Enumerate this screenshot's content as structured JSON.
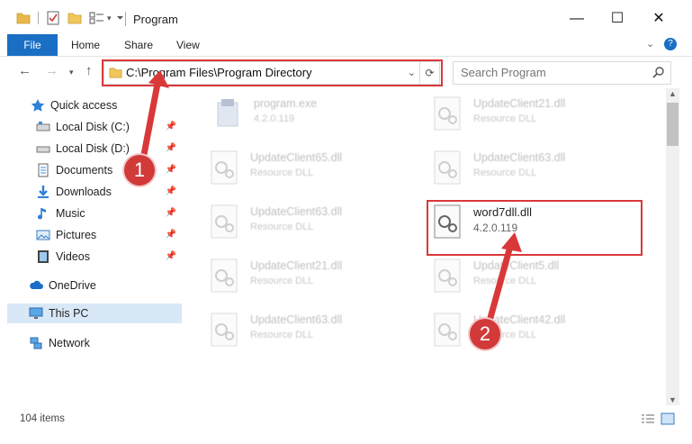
{
  "window": {
    "title": "Program",
    "controls": {
      "minimize": "—",
      "maximize": "☐",
      "close": "✕"
    }
  },
  "ribbon": {
    "tabs": [
      "File",
      "Home",
      "Share",
      "View"
    ]
  },
  "navigation": {
    "address": "C:\\Program Files\\Program Directory",
    "search_placeholder": "Search Program"
  },
  "sidebar": {
    "items": [
      {
        "label": "Quick access",
        "icon": "star-icon"
      },
      {
        "label": "Local Disk (C:)",
        "icon": "drive-icon",
        "pinned": true
      },
      {
        "label": "Local Disk (D:)",
        "icon": "drive-icon",
        "pinned": true
      },
      {
        "label": "Documents",
        "icon": "documents-icon",
        "pinned": true
      },
      {
        "label": "Downloads",
        "icon": "download-icon",
        "pinned": true
      },
      {
        "label": "Music",
        "icon": "music-icon",
        "pinned": true
      },
      {
        "label": "Pictures",
        "icon": "pictures-icon",
        "pinned": true
      },
      {
        "label": "Videos",
        "icon": "videos-icon",
        "pinned": true
      },
      {
        "label": "OneDrive",
        "icon": "cloud-icon"
      },
      {
        "label": "This PC",
        "icon": "computer-icon",
        "selected": true
      },
      {
        "label": "Network",
        "icon": "network-icon"
      }
    ]
  },
  "files": [
    {
      "name": "program.exe",
      "sub": "4.2.0.119"
    },
    {
      "name": "UpdateClient21.dll",
      "sub": "Resource DLL"
    },
    {
      "name": "UpdateClient65.dll",
      "sub": "Resource DLL"
    },
    {
      "name": "UpdateClient63.dll",
      "sub": "Resource DLL"
    },
    {
      "name": "UpdateClient63.dll",
      "sub": "Resource DLL"
    },
    {
      "name": "word7dll.dll",
      "sub": "4.2.0.119",
      "selected": true
    },
    {
      "name": "UpdateClient21.dll",
      "sub": "Resource DLL"
    },
    {
      "name": "UpdateClient5.dll",
      "sub": "Resource DLL"
    },
    {
      "name": "UpdateClient63.dll",
      "sub": "Resource DLL"
    },
    {
      "name": "UpdateClient42.dll",
      "sub": "Resource DLL"
    }
  ],
  "status": {
    "item_count": "104 items"
  },
  "annotations": {
    "step1": "1",
    "step2": "2"
  },
  "colors": {
    "accent": "#1a6fc4",
    "highlight": "#d9383a",
    "badge": "#d23a3a"
  }
}
